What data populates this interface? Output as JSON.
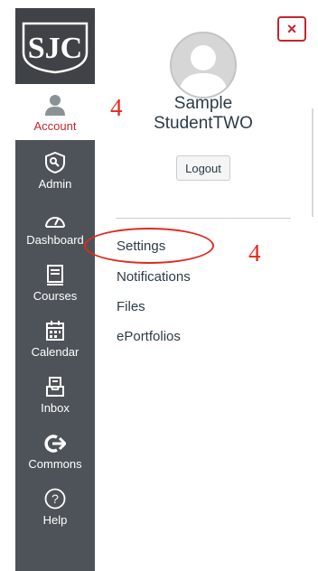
{
  "logo": {
    "text": "SJC"
  },
  "nav": {
    "items": [
      {
        "label": "Account",
        "icon": "account-icon",
        "active": true
      },
      {
        "label": "Admin",
        "icon": "admin-icon"
      },
      {
        "label": "Dashboard",
        "icon": "dashboard-icon"
      },
      {
        "label": "Courses",
        "icon": "courses-icon"
      },
      {
        "label": "Calendar",
        "icon": "calendar-icon"
      },
      {
        "label": "Inbox",
        "icon": "inbox-icon"
      },
      {
        "label": "Commons",
        "icon": "commons-icon"
      },
      {
        "label": "Help",
        "icon": "help-icon"
      }
    ]
  },
  "tray": {
    "close_label": "×",
    "user_name": "Sample StudentTWO",
    "logout_label": "Logout",
    "links": [
      {
        "label": "Settings"
      },
      {
        "label": "Notifications"
      },
      {
        "label": "Files"
      },
      {
        "label": "ePortfolios"
      }
    ]
  },
  "annotations": {
    "account_step": "4",
    "settings_step": "4"
  },
  "colors": {
    "sidebar": "#4e5359",
    "accent": "#c2262f",
    "annotation": "#e02a1e",
    "text": "#2d3b45"
  }
}
